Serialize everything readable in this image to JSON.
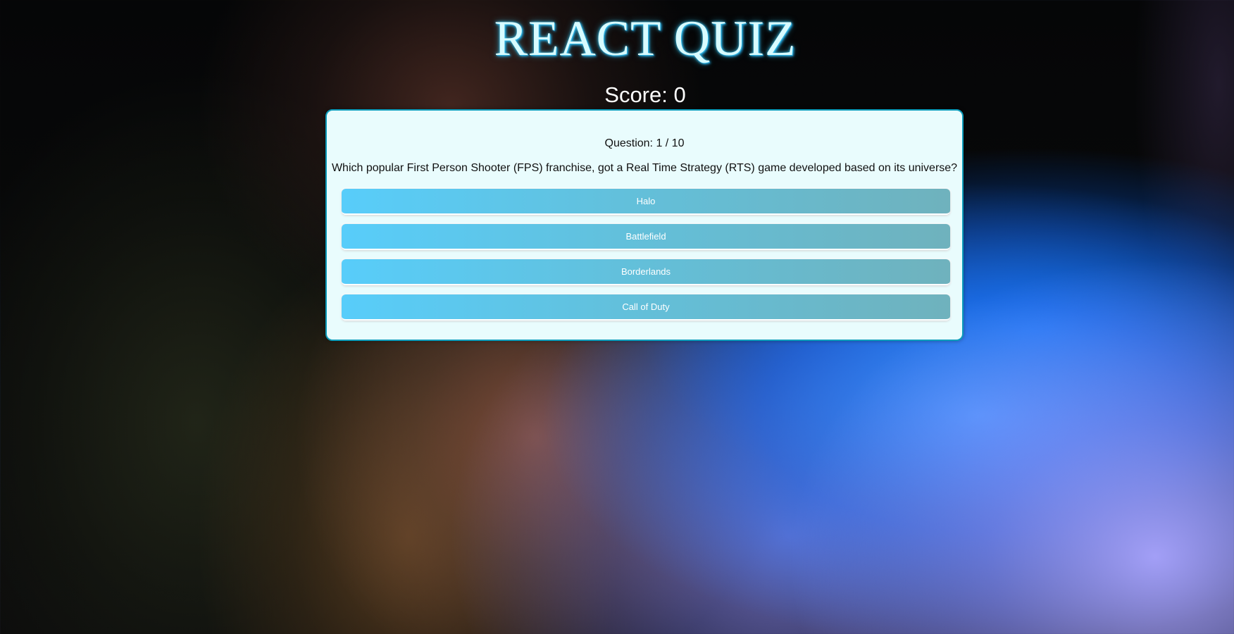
{
  "header": {
    "title": "REACT QUIZ",
    "score": "Score: 0"
  },
  "quiz": {
    "counter": "Question: 1 / 10",
    "question": "Which popular First Person Shooter (FPS) franchise, got a Real Time Strategy (RTS) game developed based on its universe?",
    "answers": [
      {
        "label": "Halo"
      },
      {
        "label": "Battlefield"
      },
      {
        "label": "Borderlands"
      },
      {
        "label": "Call of Duty"
      }
    ]
  },
  "colors": {
    "title_text": "#d8fbff",
    "title_glow": "#37c6f0",
    "card_background": "#e9fcfd",
    "card_border": "#0c9cbb",
    "answer_gradient_start": "#58cdfa",
    "answer_gradient_end": "#6fb2bd"
  }
}
